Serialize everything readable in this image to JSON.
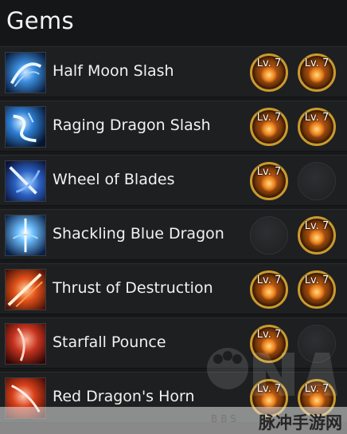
{
  "header": {
    "title": "Gems"
  },
  "skills": [
    {
      "name": "Half Moon Slash",
      "icon": "half-moon-slash-icon",
      "gems": [
        {
          "filled": true,
          "level": "Lv. 7"
        },
        {
          "filled": true,
          "level": "Lv. 7"
        }
      ]
    },
    {
      "name": "Raging Dragon Slash",
      "icon": "raging-dragon-slash-icon",
      "gems": [
        {
          "filled": true,
          "level": "Lv. 7"
        },
        {
          "filled": true,
          "level": "Lv. 7"
        }
      ]
    },
    {
      "name": "Wheel of Blades",
      "icon": "wheel-of-blades-icon",
      "gems": [
        {
          "filled": true,
          "level": "Lv. 7"
        },
        {
          "filled": false,
          "level": ""
        }
      ]
    },
    {
      "name": "Shackling Blue Dragon",
      "icon": "shackling-blue-dragon-icon",
      "gems": [
        {
          "filled": false,
          "level": ""
        },
        {
          "filled": true,
          "level": "Lv. 7"
        }
      ]
    },
    {
      "name": "Thrust of Destruction",
      "icon": "thrust-of-destruction-icon",
      "gems": [
        {
          "filled": true,
          "level": "Lv. 7"
        },
        {
          "filled": true,
          "level": "Lv. 7"
        }
      ]
    },
    {
      "name": "Starfall Pounce",
      "icon": "starfall-pounce-icon",
      "gems": [
        {
          "filled": true,
          "level": "Lv. 7"
        },
        {
          "filled": false,
          "level": ""
        }
      ]
    },
    {
      "name": "Red Dragon's Horn",
      "icon": "red-dragons-horn-icon",
      "gems": [
        {
          "filled": true,
          "level": "Lv. 7"
        },
        {
          "filled": true,
          "level": "Lv. 7"
        }
      ]
    }
  ],
  "watermark": {
    "text": "脉冲手游网",
    "bbs": "BBS",
    "logo": "nga-logo"
  },
  "colors": {
    "background": "#17181a",
    "row": "#1e1f21",
    "gem_border": "#c99a2e",
    "gem_fill": "#a94f10",
    "blue_skill": "#3a8fe0",
    "red_skill": "#d8401a"
  }
}
